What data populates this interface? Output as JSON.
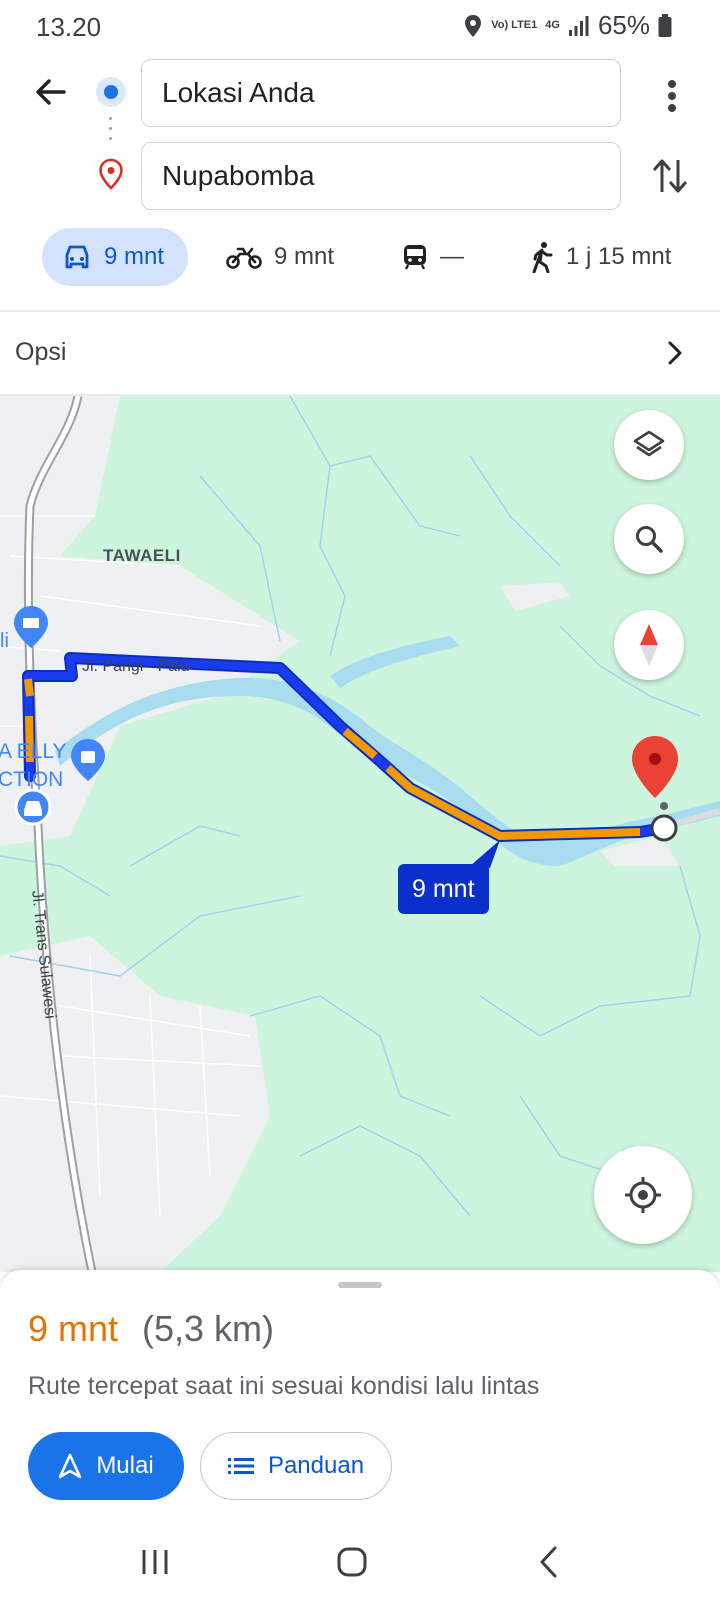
{
  "status_bar": {
    "time": "13.20",
    "network_top": "Vo) LTE1",
    "network_4g": "4G",
    "battery": "65%"
  },
  "directions": {
    "origin": "Lokasi Anda",
    "destination": "Nupabomba"
  },
  "modes": [
    {
      "icon": "car-icon",
      "label": "9 mnt",
      "active": true
    },
    {
      "icon": "motorcycle-icon",
      "label": "9 mnt",
      "active": false
    },
    {
      "icon": "transit-icon",
      "label": "—",
      "active": false
    },
    {
      "icon": "walk-icon",
      "label": "1 j 15 mnt",
      "active": false
    }
  ],
  "options": {
    "label": "Opsi"
  },
  "map": {
    "area_label": "TAWAELI",
    "road_parigi": "Jl. Parigi - Palu",
    "road_trans": "Jl. Trans Sulawesi",
    "poi_fragment_1": "A ELLY",
    "poi_fragment_2": "CTION",
    "poi_fragment_3": "li",
    "route_eta": "9 mnt"
  },
  "summary": {
    "eta": "9 mnt",
    "distance": "(5,3 km)",
    "description": "Rute tercepat saat ini sesuai kondisi lalu lintas",
    "start_label": "Mulai",
    "guide_label": "Panduan"
  },
  "colors": {
    "accent": "#1a73e8",
    "route_blue": "#1a3cf0",
    "traffic_orange": "#f29900",
    "eta_orange": "#e37400",
    "map_green": "#cdf5de",
    "destination_red": "#ea4335"
  }
}
